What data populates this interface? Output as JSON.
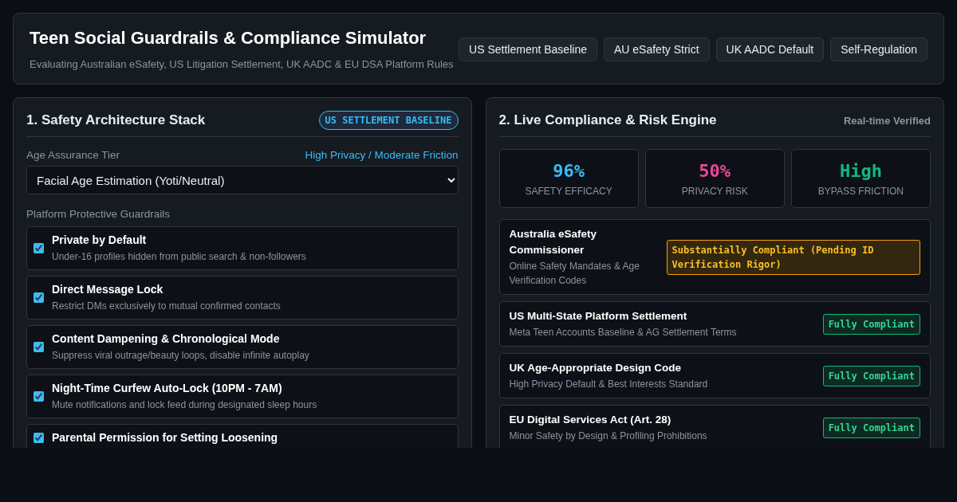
{
  "header": {
    "title": "Teen Social Guardrails & Compliance Simulator",
    "subtitle": "Evaluating Australian eSafety, US Litigation Settlement, UK AADC & EU DSA Platform Rules",
    "presets": [
      {
        "label": "US Settlement Baseline",
        "selected": false
      },
      {
        "label": "AU eSafety Strict",
        "selected": false
      },
      {
        "label": "UK AADC Default",
        "selected": false
      },
      {
        "label": "Self-Regulation",
        "selected": false
      }
    ]
  },
  "architecture": {
    "title": "1. Safety Architecture Stack",
    "badge": "US SETTLEMENT BASELINE",
    "age_tier": {
      "label": "Age Assurance Tier",
      "rating": "High Privacy / Moderate Friction",
      "value": "Facial Age Estimation (Yoti/Neutral)"
    },
    "guardrails_label": "Platform Protective Guardrails",
    "guardrails": [
      {
        "title": "Private by Default",
        "description": "Under-16 profiles hidden from public search & non-followers",
        "checked": true
      },
      {
        "title": "Direct Message Lock",
        "description": "Restrict DMs exclusively to mutual confirmed contacts",
        "checked": true
      },
      {
        "title": "Content Dampening & Chronological Mode",
        "description": "Suppress viral outrage/beauty loops, disable infinite autoplay",
        "checked": true
      },
      {
        "title": "Night-Time Curfew Auto-Lock (10PM - 7AM)",
        "description": "Mute notifications and lock feed during designated sleep hours",
        "checked": true
      },
      {
        "title": "Parental Permission for Setting Loosening",
        "checked": true
      }
    ]
  },
  "engine": {
    "title": "2. Live Compliance & Risk Engine",
    "status": "Real-time Verified",
    "metrics": [
      {
        "value": "96%",
        "label": "SAFETY EFFICACY",
        "color": "#38bdf8"
      },
      {
        "value": "50%",
        "label": "PRIVACY RISK",
        "color": "#ec4899"
      },
      {
        "value": "High",
        "label": "BYPASS FRICTION",
        "color": "#10b981"
      }
    ],
    "regulations": [
      {
        "name": "Australia eSafety Commissioner",
        "description": "Online Safety Mandates & Age Verification Codes",
        "verdict": "Substantially Compliant (Pending ID Verification Rigor)",
        "kind": "partial"
      },
      {
        "name": "US Multi-State Platform Settlement",
        "description": "Meta Teen Accounts Baseline & AG Settlement Terms",
        "verdict": "Fully Compliant",
        "kind": "full"
      },
      {
        "name": "UK Age-Appropriate Design Code",
        "description": "High Privacy Default & Best Interests Standard",
        "verdict": "Fully Compliant",
        "kind": "full"
      },
      {
        "name": "EU Digital Services Act (Art. 28)",
        "description": "Minor Safety by Design & Profiling Prohibitions",
        "verdict": "Fully Compliant",
        "kind": "full"
      }
    ]
  }
}
